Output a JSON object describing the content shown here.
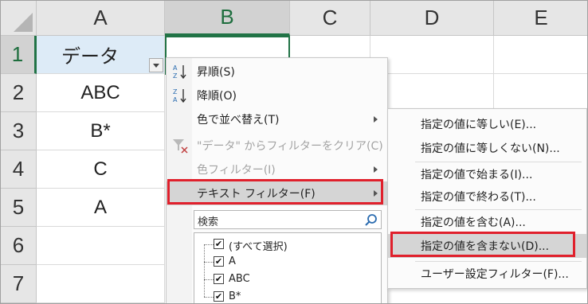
{
  "sheet": {
    "columns": [
      "A",
      "B",
      "C",
      "D",
      "E"
    ],
    "rows": [
      "1",
      "2",
      "3",
      "4",
      "5",
      "6",
      "7"
    ],
    "cells": {
      "A1": "データ",
      "A2": "ABC",
      "A3": "B*",
      "A4": "C",
      "A5": "A"
    },
    "active_cell": "B1"
  },
  "filter_menu": {
    "sort_asc": "昇順(S)",
    "sort_desc": "降順(O)",
    "sort_by_color": "色で並べ替え(T)",
    "clear_filter": "\"データ\" からフィルターをクリア(C)",
    "color_filter": "色フィルター(I)",
    "text_filter": "テキスト フィルター(F)",
    "search_placeholder": "検索",
    "list_items": [
      "(すべて選択)",
      "A",
      "ABC",
      "B*"
    ]
  },
  "text_filter_submenu": {
    "items": [
      "指定の値に等しい(E)...",
      "指定の値に等しくない(N)...",
      "指定の値で始まる(I)...",
      "指定の値で終わる(T)...",
      "指定の値を含む(A)...",
      "指定の値を含まない(D)...",
      "ユーザー設定フィルター(F)..."
    ],
    "highlighted_index": 5
  },
  "colors": {
    "header_fill": "#ddebf7",
    "selected_accent": "#217346",
    "highlight_box": "#e0202c"
  }
}
